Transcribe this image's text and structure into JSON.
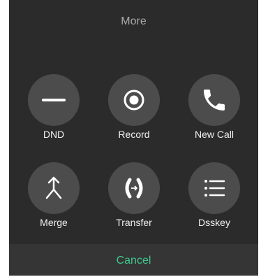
{
  "dialog": {
    "title": "More",
    "cancel_label": "Cancel",
    "accent_color": "#3fc78d",
    "actions": [
      {
        "label": "DND",
        "icon": "minus-icon"
      },
      {
        "label": "Record",
        "icon": "record-icon"
      },
      {
        "label": "New Call",
        "icon": "phone-icon"
      },
      {
        "label": "Merge",
        "icon": "merge-icon"
      },
      {
        "label": "Transfer",
        "icon": "transfer-icon"
      },
      {
        "label": "Dsskey",
        "icon": "list-icon"
      }
    ]
  }
}
